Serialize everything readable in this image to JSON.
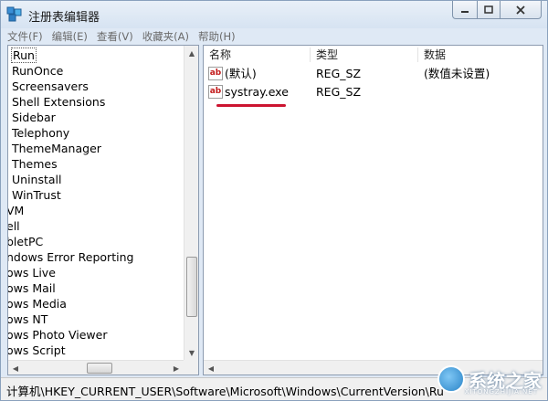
{
  "window": {
    "title": "注册表编辑器"
  },
  "menu": [
    "文件(F)",
    "编辑(E)",
    "查看(V)",
    "收藏夹(A)",
    "帮助(H)"
  ],
  "tree": {
    "items": [
      {
        "label": "Run",
        "selected": true
      },
      {
        "label": "RunOnce"
      },
      {
        "label": "Screensavers"
      },
      {
        "label": "Shell Extensions"
      },
      {
        "label": "Sidebar"
      },
      {
        "label": "Telephony"
      },
      {
        "label": "ThemeManager"
      },
      {
        "label": "Themes"
      },
      {
        "label": "Uninstall"
      },
      {
        "label": "WinTrust"
      },
      {
        "label": "VM"
      },
      {
        "label": "ell"
      },
      {
        "label": "bletPC"
      },
      {
        "label": "ndows Error Reporting"
      },
      {
        "label": "ows Live"
      },
      {
        "label": "ows Mail"
      },
      {
        "label": "ows Media"
      },
      {
        "label": "ows NT"
      },
      {
        "label": "ows Photo Viewer"
      },
      {
        "label": "ows Script"
      }
    ]
  },
  "list": {
    "columns": [
      "名称",
      "类型",
      "数据"
    ],
    "rows": [
      {
        "icon": "ab",
        "name": "(默认)",
        "type": "REG_SZ",
        "data": "(数值未设置)"
      },
      {
        "icon": "ab",
        "name": "systray.exe",
        "type": "REG_SZ",
        "data": ""
      }
    ]
  },
  "status": {
    "path": "计算机\\HKEY_CURRENT_USER\\Software\\Microsoft\\Windows\\CurrentVersion\\Ru"
  },
  "watermark": {
    "text": "系统之家",
    "sub": "XITONGZHIJIA.NET"
  },
  "colors": {
    "highlight_underline": "#cc1430",
    "titlebar": "#dfe9f5"
  }
}
